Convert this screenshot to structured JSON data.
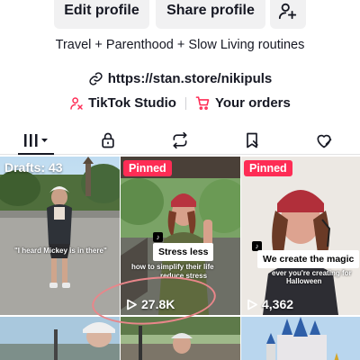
{
  "header": {
    "edit_profile_label": "Edit profile",
    "share_profile_label": "Share profile",
    "add_friend_icon": "person-plus-icon"
  },
  "profile": {
    "bio": "Travel + Parenthood + Slow Living routines",
    "link": "https://stan.store/nikipuls",
    "studio_label": "TikTok Studio",
    "orders_label": "Your orders"
  },
  "tabs": [
    {
      "icon": "grid-icon",
      "active": true
    },
    {
      "icon": "lock-icon",
      "active": false
    },
    {
      "icon": "repost-icon",
      "active": false
    },
    {
      "icon": "bookmark-icon",
      "active": false
    },
    {
      "icon": "liked-heart-icon",
      "active": false
    }
  ],
  "videos": [
    {
      "badge": "Drafts: 43",
      "caption": "\"I heard Mickey is in there\""
    },
    {
      "badge": "Pinned",
      "caption_box": "Stress less",
      "caption_small_1": "how to simplify their life",
      "caption_small_2": "reduce stress",
      "views": "27.8K"
    },
    {
      "badge": "Pinned",
      "caption_box": "We create the magic",
      "caption_small_1": "ever you're creating for",
      "caption_small_2": "Halloween",
      "views": "4,362"
    }
  ],
  "colors": {
    "pinned_bg": "#fe2c55",
    "studio_icon": "#fe2c55",
    "annotation_circle": "#e9868a"
  }
}
